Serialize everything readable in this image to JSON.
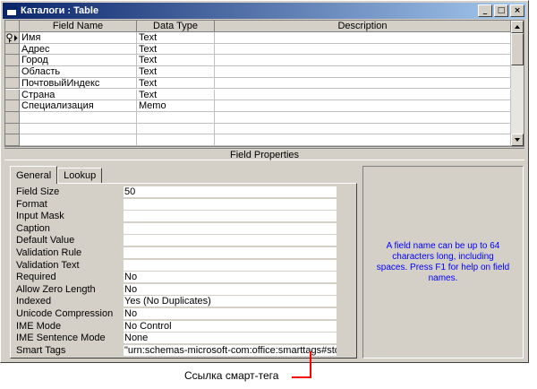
{
  "window": {
    "title": "Каталоги : Table",
    "buttons": {
      "minimize": "_",
      "maximize": "□",
      "close": "×"
    }
  },
  "grid": {
    "columns": [
      "Field Name",
      "Data Type",
      "Description"
    ],
    "rows": [
      {
        "name": "Имя",
        "type": "Text",
        "description": ""
      },
      {
        "name": "Адрес",
        "type": "Text",
        "description": ""
      },
      {
        "name": "Город",
        "type": "Text",
        "description": ""
      },
      {
        "name": "Область",
        "type": "Text",
        "description": ""
      },
      {
        "name": "ПочтовыйИндекс",
        "type": "Text",
        "description": ""
      },
      {
        "name": "Страна",
        "type": "Text",
        "description": ""
      },
      {
        "name": "Специализация",
        "type": "Memo",
        "description": ""
      }
    ],
    "primary_key_icon": "key-icon",
    "current_row_icon": "row-pointer-icon"
  },
  "field_properties": {
    "title": "Field Properties",
    "tabs": [
      "General",
      "Lookup"
    ],
    "properties": [
      {
        "label": "Field Size",
        "value": "50"
      },
      {
        "label": "Format",
        "value": ""
      },
      {
        "label": "Input Mask",
        "value": ""
      },
      {
        "label": "Caption",
        "value": ""
      },
      {
        "label": "Default Value",
        "value": ""
      },
      {
        "label": "Validation Rule",
        "value": ""
      },
      {
        "label": "Validation Text",
        "value": ""
      },
      {
        "label": "Required",
        "value": "No"
      },
      {
        "label": "Allow Zero Length",
        "value": "No"
      },
      {
        "label": "Indexed",
        "value": "Yes (No Duplicates)"
      },
      {
        "label": "Unicode Compression",
        "value": "No"
      },
      {
        "label": "IME Mode",
        "value": "No Control"
      },
      {
        "label": "IME Sentence Mode",
        "value": "None"
      },
      {
        "label": "Smart Tags",
        "value": "\"urn:schemas-microsoft-com:office:smarttags#stoc"
      }
    ],
    "help_text": "A field name can be up to 64 characters long, including spaces. Press F1 for help on field names."
  },
  "annotation": {
    "text": "Ссылка смарт-тега",
    "color": "#ff0000"
  },
  "colors": {
    "title_gradient_start": "#0a246a",
    "title_gradient_end": "#a6caf0",
    "face": "#d4d0c8",
    "help_text": "#0000ff"
  }
}
